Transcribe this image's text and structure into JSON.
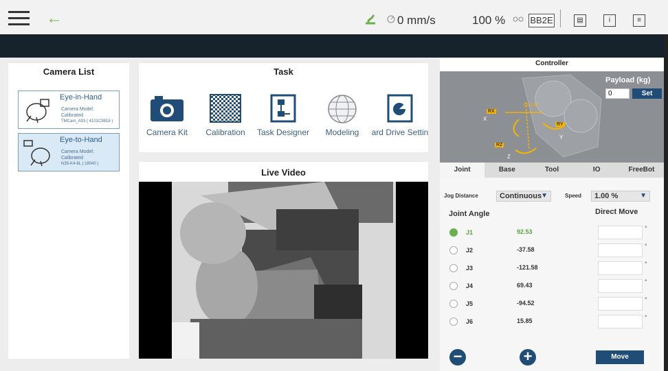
{
  "topbar": {
    "speed": "0 mm/s",
    "percent": "100 %",
    "badge": "BB2E",
    "icons": [
      "hamburger-icon",
      "back-arrow-icon",
      "green-robot-icon",
      "speed-icon",
      "link-icon",
      "display-icon",
      "info-icon",
      "notes-icon"
    ],
    "info_label": "i"
  },
  "camera_list": {
    "title": "Camera List",
    "cameras": [
      {
        "name": "Eye-in-Hand",
        "info1": "Camera Model:",
        "info2": "Calibrated",
        "info3": "TMCam_A93 ( 4101C9818 )"
      },
      {
        "name": "Eye-to-Hand",
        "info1": "Camera Model:",
        "info2": "Calibrated",
        "info3": "N35-K4-6L ( 18040 )"
      }
    ]
  },
  "task": {
    "title": "Task",
    "items": [
      {
        "label": "Camera Kit",
        "icon": "camera-icon"
      },
      {
        "label": "Calibration",
        "icon": "checkerboard-icon"
      },
      {
        "label": "Task Designer",
        "icon": "flowchart-icon"
      },
      {
        "label": "Modeling",
        "icon": "globe-icon"
      },
      {
        "label": "ard Drive Settin",
        "icon": "drive-icon"
      }
    ]
  },
  "live_video": {
    "title": "Live Video"
  },
  "controller": {
    "title": "Controller",
    "payload_label": "Payload (kg)",
    "payload_value": "0",
    "set_label": "Set",
    "axes": [
      "RX",
      "(0,0,0)",
      "RY",
      "RZ",
      "X",
      "Y",
      "Z"
    ],
    "tabs": [
      "Joint",
      "Base",
      "Tool",
      "IO",
      "FreeBot"
    ],
    "jog_distance_label": "Jog Distance",
    "jog_distance_value": "Continuous",
    "speed_label": "Speed",
    "speed_value": "1.00 %",
    "joint_angle_label": "Joint Angle",
    "direct_move_label": "Direct Move",
    "joints": [
      {
        "name": "J1",
        "value": "92.53"
      },
      {
        "name": "J2",
        "value": "-37.58"
      },
      {
        "name": "J3",
        "value": "-121.58"
      },
      {
        "name": "J4",
        "value": "69.43"
      },
      {
        "name": "J5",
        "value": "-94.52"
      },
      {
        "name": "J6",
        "value": "15.85"
      }
    ],
    "degree_symbol": "°",
    "minus_label": "−",
    "plus_label": "+",
    "move_label": "Move"
  }
}
